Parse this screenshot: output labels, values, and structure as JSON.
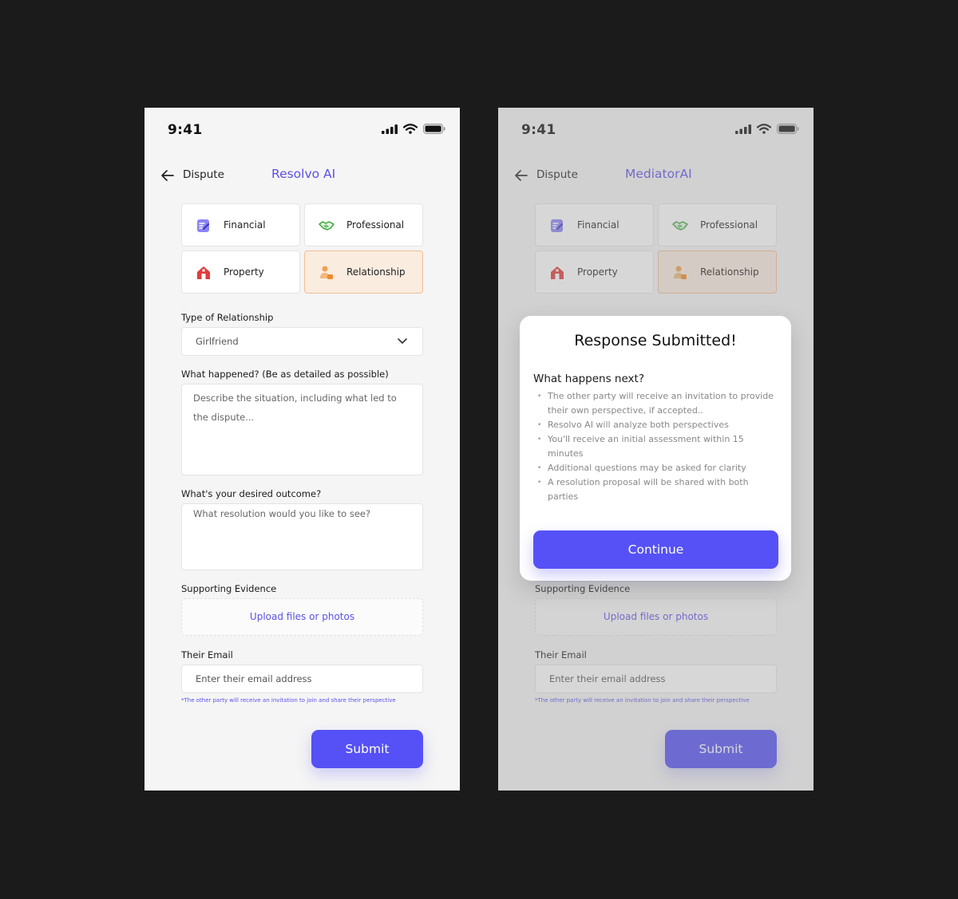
{
  "left": {
    "status_time": "9:41",
    "nav": {
      "title": "Dispute",
      "brand": "Resolvo AI"
    },
    "categories": [
      {
        "label": "Financial"
      },
      {
        "label": "Professional"
      },
      {
        "label": "Property"
      },
      {
        "label": "Relationship"
      }
    ],
    "relationship_type": {
      "label": "Type of Relationship",
      "value": "Girlfriend"
    },
    "what_happened": {
      "label": "What happened? (Be as detailed as possible)",
      "placeholder": "Describe the situation, including what led to the dispute..."
    },
    "desired_outcome": {
      "label": "What's your desired outcome?",
      "placeholder": "What resolution would you like to see?"
    },
    "evidence": {
      "label": "Supporting Evidence",
      "upload_label": "Upload files or photos"
    },
    "email": {
      "label": "Their Email",
      "placeholder": "Enter their email address",
      "note": "*The other party will receive an invitation to join and share their perspective"
    },
    "submit_label": "Submit"
  },
  "right": {
    "status_time": "9:41",
    "nav": {
      "title": "Dispute",
      "brand": "MediatorAI"
    },
    "categories": [
      {
        "label": "Financial"
      },
      {
        "label": "Professional"
      },
      {
        "label": "Property"
      },
      {
        "label": "Relationship"
      }
    ],
    "evidence": {
      "label": "Supporting Evidence",
      "upload_label": "Upload files or photos"
    },
    "email": {
      "label": "Their Email",
      "placeholder": "Enter their email address",
      "note": "*The other party will receive an invitation to join and share their perspective"
    },
    "submit_label": "Submit",
    "modal": {
      "title": "Response Submitted!",
      "subtitle": "What happens next?",
      "items": [
        "The other party will receive an invitation to provide their own perspective, if accepted..",
        "Resolvo AI will analyze both perspectives",
        "You'll receive an initial assessment within 15 minutes",
        "Additional questions may be asked for clarity",
        "A resolution proposal will be shared with both parties"
      ],
      "continue_label": "Continue"
    }
  },
  "colors": {
    "accent": "#5551f6",
    "brand_text": "#5b51e8",
    "selected_bg": "#fbece0",
    "selected_border": "#f0bf95"
  }
}
